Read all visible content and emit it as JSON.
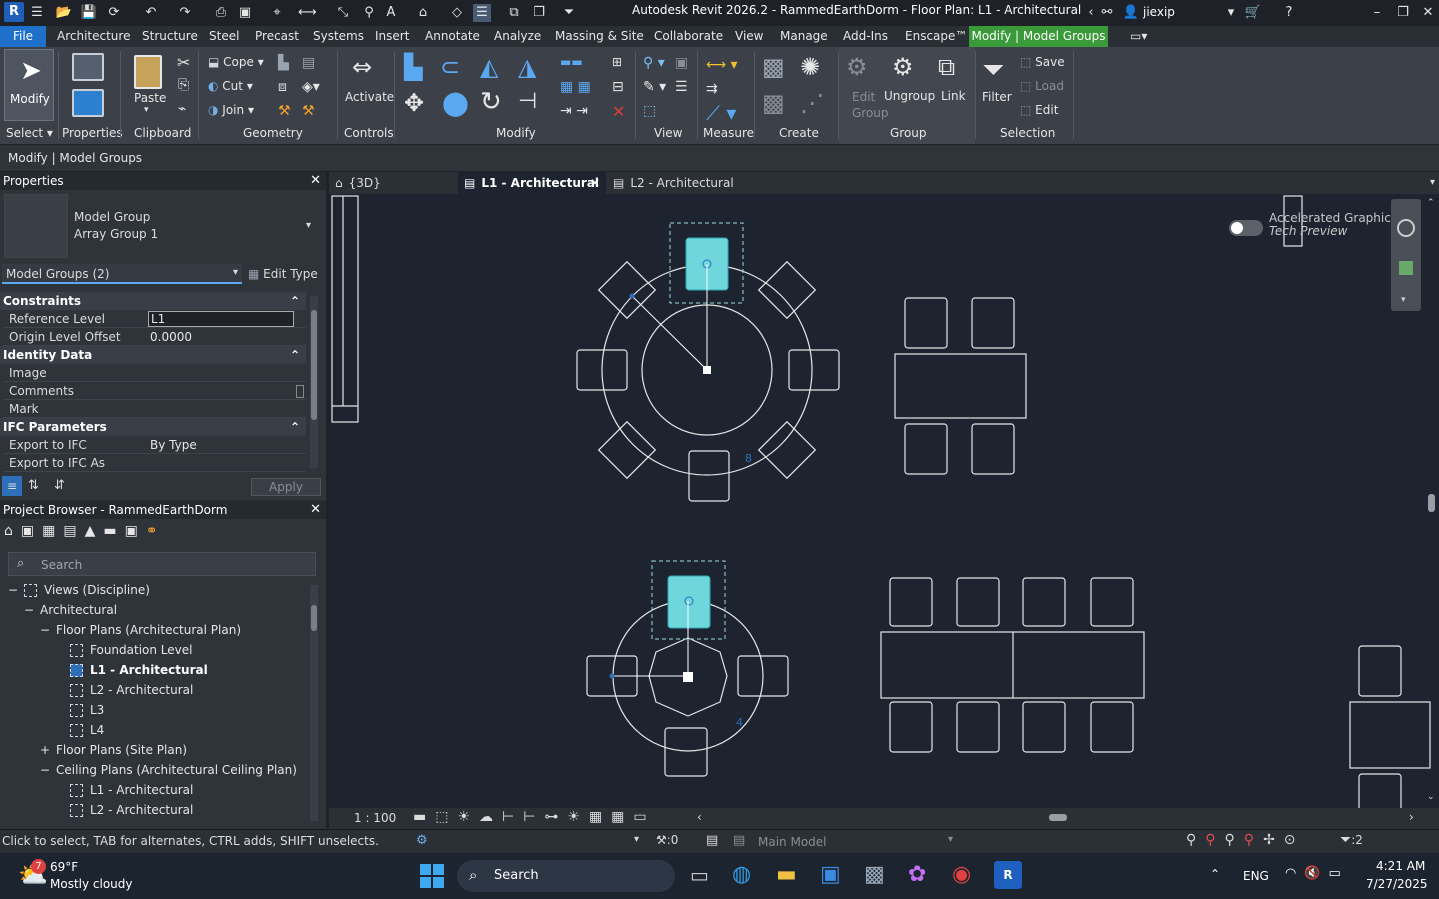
{
  "app": {
    "title": "Autodesk Revit 2026.2 - RammedEarthDorm - Floor Plan: L1 - Architectural",
    "logo": "R",
    "user": "jiexip"
  },
  "menu": {
    "file": "File",
    "items": [
      "Architecture",
      "Structure",
      "Steel",
      "Precast",
      "Systems",
      "Insert",
      "Annotate",
      "Analyze",
      "Massing & Site",
      "Collaborate",
      "View",
      "Manage",
      "Add-Ins",
      "Enscape™"
    ],
    "context_tab": "Modify | Model Groups"
  },
  "ribbon": {
    "modify": "Modify",
    "select": "Select",
    "properties": "Properties",
    "paste": "Paste",
    "clipboard": "Clipboard",
    "cope": "Cope",
    "cut": "Cut",
    "join": "Join",
    "geometry": "Geometry",
    "activate": "Activate",
    "controls": "Controls",
    "modify_panel": "Modify",
    "view": "View",
    "measure": "Measure",
    "create": "Create",
    "edit_group": "Edit Group",
    "ungroup": "Ungroup",
    "link": "Link",
    "group": "Group",
    "filter": "Filter",
    "save": "Save",
    "load": "Load",
    "edit": "Edit",
    "selection": "Selection"
  },
  "option_bar": "Modify | Model Groups",
  "properties": {
    "title": "Properties",
    "type_line1": "Model Group",
    "type_line2": "Array Group 1",
    "selector": "Model Groups (2)",
    "edit_type": "Edit Type",
    "groups": [
      {
        "name": "Constraints",
        "rows": [
          {
            "k": "Reference Level",
            "v": "L1"
          },
          {
            "k": "Origin Level Offset",
            "v": "0.0000"
          }
        ]
      },
      {
        "name": "Identity Data",
        "rows": [
          {
            "k": "Image",
            "v": ""
          },
          {
            "k": "Comments",
            "v": ""
          },
          {
            "k": "Mark",
            "v": ""
          }
        ]
      },
      {
        "name": "IFC Parameters",
        "rows": [
          {
            "k": "Export to IFC",
            "v": "By Type"
          },
          {
            "k": "Export to IFC As",
            "v": ""
          }
        ]
      }
    ],
    "apply": "Apply"
  },
  "browser": {
    "title": "Project Browser - RammedEarthDorm",
    "search_placeholder": "Search",
    "tree": [
      {
        "label": "Views (Discipline)",
        "level": 0,
        "toggle": "−",
        "icon": true
      },
      {
        "label": "Architectural",
        "level": 1,
        "toggle": "−"
      },
      {
        "label": "Floor Plans (Architectural Plan)",
        "level": 2,
        "toggle": "−"
      },
      {
        "label": "Foundation Level",
        "level": 3,
        "icon": true
      },
      {
        "label": "L1 - Architectural",
        "level": 3,
        "icon": true,
        "bold": true
      },
      {
        "label": "L2 - Architectural",
        "level": 3,
        "icon": true
      },
      {
        "label": "L3",
        "level": 3,
        "icon": true
      },
      {
        "label": "L4",
        "level": 3,
        "icon": true
      },
      {
        "label": "Floor Plans (Site Plan)",
        "level": 2,
        "toggle": "+"
      },
      {
        "label": "Ceiling Plans (Architectural Ceiling Plan)",
        "level": 2,
        "toggle": "−"
      },
      {
        "label": "L1 - Architectural",
        "level": 3,
        "icon": true
      },
      {
        "label": "L2 - Architectural",
        "level": 3,
        "icon": true
      }
    ]
  },
  "tabs": [
    "{3D}",
    "L1 - Architectural",
    "L2 - Architectural"
  ],
  "canvas": {
    "accelerated_line1": "Accelerated Graphics",
    "accelerated_line2": "Tech Preview",
    "dim_top": "8",
    "dim_bottom": "4"
  },
  "viewbar": {
    "scale": "1 : 100"
  },
  "status": {
    "message": "Click to select, TAB for alternates, CTRL adds, SHIFT unselects.",
    "worksets": ":0",
    "model": "Main Model",
    "filter_count": ":2"
  },
  "taskbar": {
    "temp": "69°F",
    "weather": "Mostly cloudy",
    "badge": "7",
    "search": "Search",
    "lang": "ENG",
    "time": "4:21 AM",
    "date": "7/27/2025"
  }
}
